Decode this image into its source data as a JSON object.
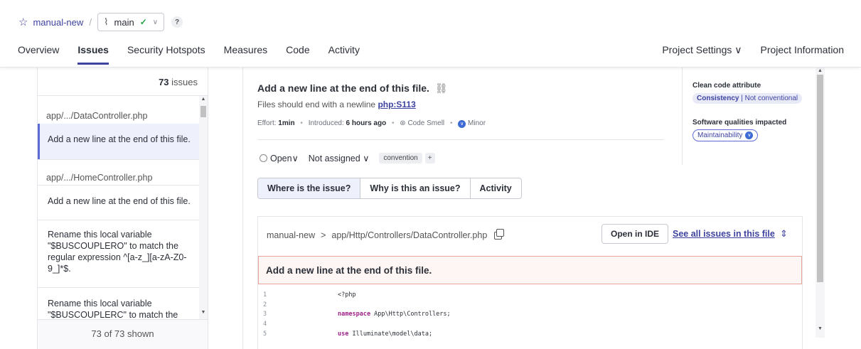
{
  "header": {
    "project": "manual-new",
    "separator": "/",
    "branch": "main",
    "help": "?"
  },
  "nav": {
    "tabs": [
      "Overview",
      "Issues",
      "Security Hotspots",
      "Measures",
      "Code",
      "Activity"
    ],
    "active": "Issues",
    "right": [
      "Project Settings ∨",
      "Project Information"
    ]
  },
  "issue_list": {
    "count_num": "73",
    "count_label": " issues",
    "items": [
      {
        "type": "file",
        "text": "app/.../DataController.php"
      },
      {
        "type": "issue",
        "text": "Add a new line at the end of this file.",
        "selected": true
      },
      {
        "type": "file",
        "text": "app/.../HomeController.php"
      },
      {
        "type": "issue",
        "text": "Add a new line at the end of this file."
      },
      {
        "type": "issue",
        "text": "Rename this local variable \"$BUSCOUPLERO\" to match the regular expression ^[a-z_][a-zA-Z0-9_]*$."
      },
      {
        "type": "issue",
        "text": "Rename this local variable \"$BUSCOUPLERC\" to match the"
      }
    ],
    "footer": "73 of 73 shown"
  },
  "issue": {
    "title": "Add a new line at the end of this file.",
    "subtitle_prefix": "Files should end with a newline ",
    "rule": "php:S113",
    "meta": {
      "effort_label": "Effort: ",
      "effort": "1min",
      "introduced_label": "Introduced: ",
      "introduced": "6 hours ago",
      "type": "Code Smell",
      "severity": "Minor"
    },
    "status": "Open",
    "assignee": "Not assigned",
    "tag": "convention",
    "tag_add": "+",
    "tabs": [
      "Where is the issue?",
      "Why is this an issue?",
      "Activity"
    ],
    "selected_tab": "Where is the issue?"
  },
  "attributes": {
    "clean_code_title": "Clean code attribute",
    "clean_code_value": "Consistency",
    "clean_code_detail": "Not conventional",
    "qualities_title": "Software qualities impacted",
    "quality": "Maintainability"
  },
  "code_view": {
    "project": "manual-new",
    "arrow": ">",
    "path": "app/Http/Controllers/DataController.php",
    "open_ide": "Open in IDE",
    "see_all": "See all issues in this file",
    "banner": "Add a new line at the end of this file.",
    "lines": [
      {
        "n": "1",
        "kw": "",
        "code": "<?php"
      },
      {
        "n": "2",
        "kw": "",
        "code": ""
      },
      {
        "n": "3",
        "kw": "namespace",
        "code": " App\\Http\\Controllers;"
      },
      {
        "n": "4",
        "kw": "",
        "code": ""
      },
      {
        "n": "5",
        "kw": "use",
        "code": " Illuminate\\model\\data;"
      }
    ]
  },
  "colors": {
    "accent": "#3e43a0",
    "issue_border": "#e8a39d",
    "selected_bg": "#eef0fb"
  }
}
